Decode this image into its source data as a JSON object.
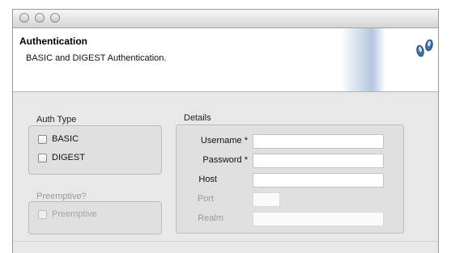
{
  "header": {
    "title": "Authentication",
    "subtitle": "BASIC and DIGEST Authentication.",
    "logo_icon": "footprints-icon",
    "accent_color": "#3f6fa6"
  },
  "titlebar": {
    "buttons": [
      "close-button",
      "minimize-button",
      "zoom-button"
    ]
  },
  "auth_type": {
    "label": "Auth Type",
    "options": [
      {
        "label": "BASIC",
        "checked": false
      },
      {
        "label": "DIGEST",
        "checked": false
      }
    ]
  },
  "preemptive": {
    "label": "Preemptive?",
    "option": {
      "label": "Preemptive",
      "checked": false,
      "enabled": false
    }
  },
  "details": {
    "label": "Details",
    "fields": {
      "username": {
        "label": "Username *",
        "value": "",
        "enabled": true
      },
      "password": {
        "label": "Password *",
        "value": "",
        "enabled": true
      },
      "host": {
        "label": "Host",
        "value": "",
        "enabled": true
      },
      "port": {
        "label": "Port",
        "value": "",
        "enabled": false
      },
      "realm": {
        "label": "Realm",
        "value": "",
        "enabled": false
      }
    }
  }
}
